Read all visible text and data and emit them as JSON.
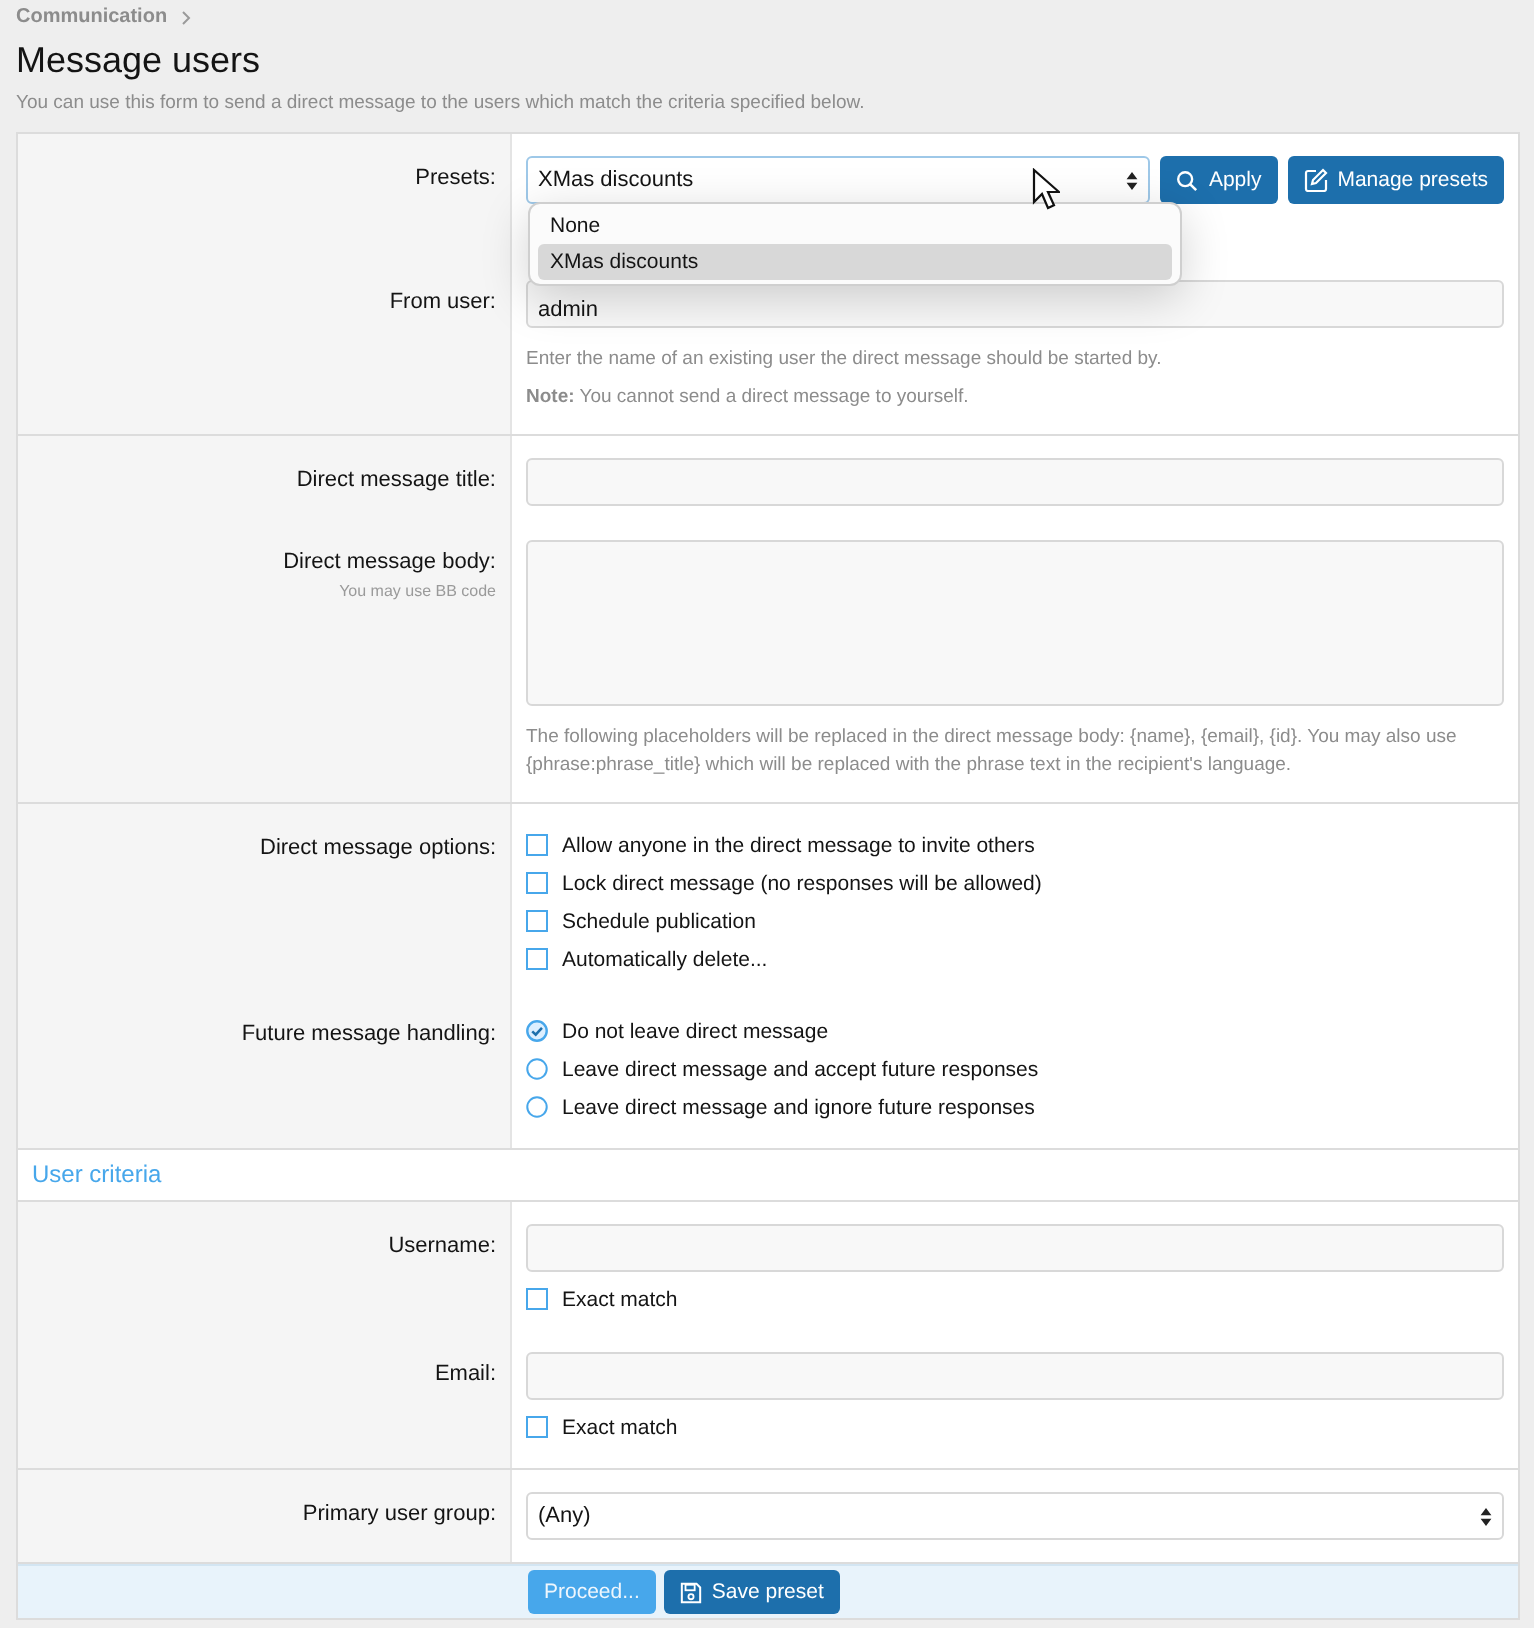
{
  "breadcrumb": [
    "Communication"
  ],
  "title": "Message users",
  "description": "You can use this form to send a direct message to the users which match the criteria specified below.",
  "sections": [
    {
      "groups": [
        [
          {
            "kind": "preset",
            "label": "Presets:",
            "value": "XMas discounts",
            "buttons": [
              {
                "label": "Apply"
              },
              {
                "label": "Manage presets"
              }
            ],
            "dropdown": {
              "open": true,
              "options": [
                {
                  "label": "None",
                  "selected": false
                },
                {
                  "label": "XMas discounts",
                  "selected": true
                }
              ]
            }
          },
          {
            "kind": "text",
            "label": "From user:",
            "value": "admin",
            "hints": [
              "Enter the name of an existing user the direct message should be started by.",
              "**Note:** You cannot send a direct message to yourself."
            ]
          }
        ],
        [
          {
            "kind": "text",
            "label": "Direct message title:"
          },
          {
            "kind": "textarea",
            "label": "Direct message body:",
            "sublabel": "You may use BB code",
            "hints": [
              "The following placeholders will be replaced in the direct message body: {name}, {email}, {id}. You may also use {phrase:phrase_title} which will be replaced with the phrase text in the recipient's language."
            ]
          }
        ],
        [
          {
            "kind": "checkboxes",
            "label": "Direct message options:",
            "options": [
              {
                "label": "Allow anyone in the direct message to invite others",
                "checked": false
              },
              {
                "label": "Lock direct message (no responses will be allowed)",
                "checked": false
              },
              {
                "label": "Schedule publication",
                "checked": false
              },
              {
                "label": "Automatically delete...",
                "checked": false
              }
            ]
          },
          {
            "kind": "radios",
            "label": "Future message handling:",
            "options": [
              {
                "label": "Do not leave direct message",
                "selected": true
              },
              {
                "label": "Leave direct message and accept future responses",
                "selected": false
              },
              {
                "label": "Leave direct message and ignore future responses",
                "selected": false
              }
            ]
          }
        ]
      ]
    },
    {
      "heading": "User criteria",
      "groups": [
        [
          {
            "kind": "text",
            "label": "Username:",
            "options": [
              {
                "label": "Exact match",
                "checked": false
              }
            ]
          },
          {
            "kind": "text",
            "label": "Email:",
            "options": [
              {
                "label": "Exact match",
                "checked": false
              }
            ]
          }
        ],
        [
          {
            "kind": "select",
            "label": "Primary user group:",
            "value": "(Any)"
          }
        ]
      ]
    }
  ],
  "footer_buttons": [
    {
      "label": "Proceed...",
      "disabled": true
    },
    {
      "label": "Save preset",
      "disabled": false
    }
  ]
}
